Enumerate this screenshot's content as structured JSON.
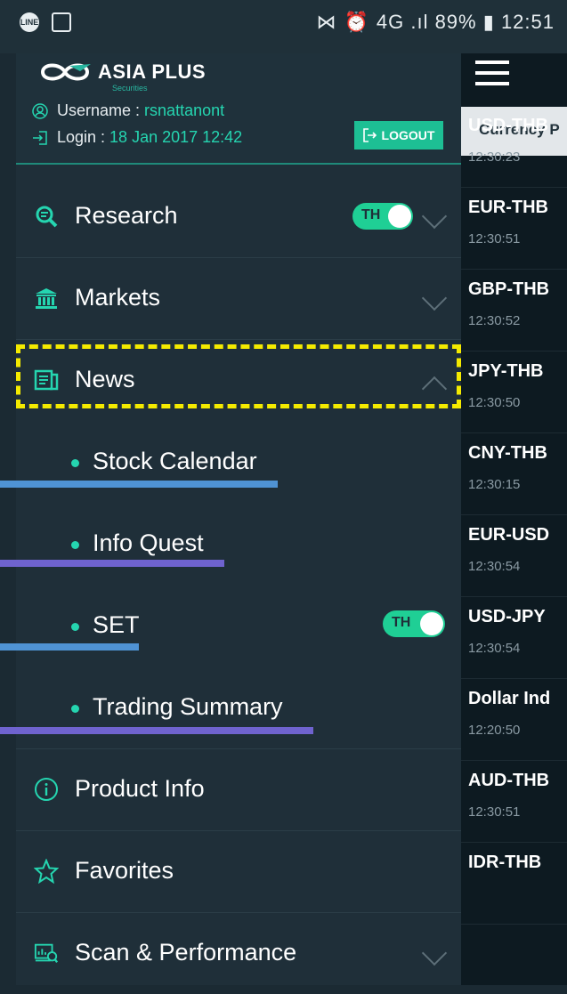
{
  "status_bar": {
    "right_text": "4G .ıl 89% ▮ 12:51"
  },
  "header": {
    "brand": "ASIA PLUS",
    "brand_sub": "Securities",
    "username_label": "Username : ",
    "username_value": "rsnattanont",
    "login_label": "Login : ",
    "login_value": "18 Jan 2017 12:42",
    "logout_label": "LOGOUT"
  },
  "menu": {
    "research": {
      "label": "Research",
      "toggle_label": "TH"
    },
    "markets": {
      "label": "Markets"
    },
    "news": {
      "label": "News"
    },
    "sub": {
      "stock_calendar": "Stock Calendar",
      "info_quest": "Info Quest",
      "set": "SET",
      "set_toggle": "TH",
      "trading_summary": "Trading Summary"
    },
    "product_info": {
      "label": "Product Info"
    },
    "favorites": {
      "label": "Favorites"
    },
    "scan": {
      "label": "Scan & Performance"
    }
  },
  "panel": {
    "tab_header": "Currency P",
    "rows": [
      {
        "pair": "USD-THB",
        "time": "12:30:23"
      },
      {
        "pair": "EUR-THB",
        "time": "12:30:51"
      },
      {
        "pair": "GBP-THB",
        "time": "12:30:52"
      },
      {
        "pair": "JPY-THB",
        "time": "12:30:50"
      },
      {
        "pair": "CNY-THB",
        "time": "12:30:15"
      },
      {
        "pair": "EUR-USD",
        "time": "12:30:54"
      },
      {
        "pair": "USD-JPY",
        "time": "12:30:54"
      },
      {
        "pair": "Dollar Ind",
        "time": "12:20:50"
      },
      {
        "pair": "AUD-THB",
        "time": "12:30:51"
      },
      {
        "pair": "IDR-THB",
        "time": ""
      }
    ]
  },
  "colors": {
    "accent": "#25d5b0",
    "highlight": "#f4ea00",
    "underline_blue": "#4f93d4",
    "underline_purple": "#6f63cf"
  }
}
